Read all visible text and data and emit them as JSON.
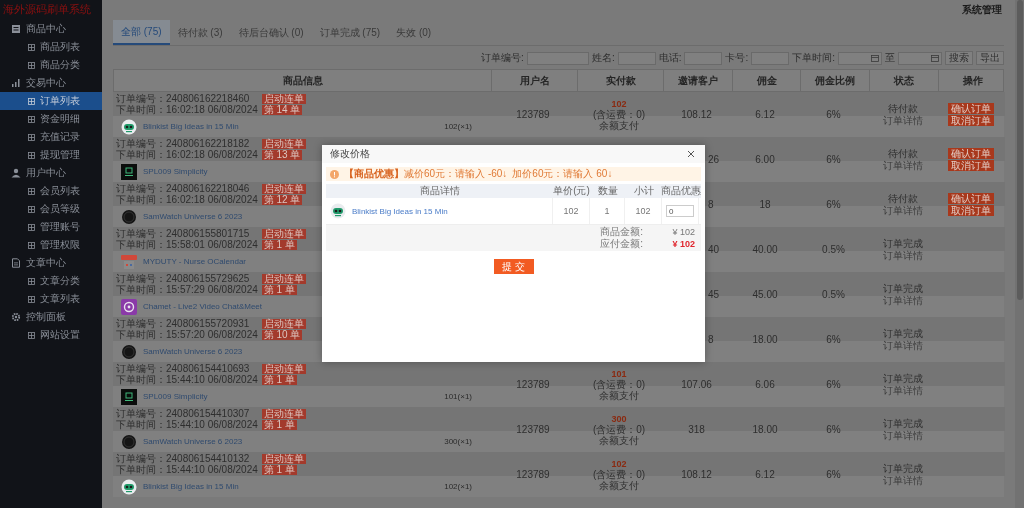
{
  "sidebar": {
    "title": "海外源码刷单系统",
    "groups": [
      {
        "label": "商品中心",
        "children": [
          {
            "label": "商品列表",
            "selected": false
          },
          {
            "label": "商品分类",
            "selected": false
          }
        ]
      },
      {
        "label": "交易中心",
        "children": [
          {
            "label": "订单列表",
            "selected": true
          },
          {
            "label": "资金明细",
            "selected": false
          },
          {
            "label": "充值记录",
            "selected": false
          },
          {
            "label": "提现管理",
            "selected": false
          }
        ]
      },
      {
        "label": "用户中心",
        "children": [
          {
            "label": "会员列表",
            "selected": false
          },
          {
            "label": "会员等级",
            "selected": false
          },
          {
            "label": "管理账号",
            "selected": false
          },
          {
            "label": "管理权限",
            "selected": false
          }
        ]
      },
      {
        "label": "文章中心",
        "children": [
          {
            "label": "文章分类",
            "selected": false
          },
          {
            "label": "文章列表",
            "selected": false
          }
        ]
      },
      {
        "label": "控制面板",
        "children": [
          {
            "label": "网站设置",
            "selected": false
          }
        ]
      }
    ]
  },
  "header": {
    "user_menu": "系统管理"
  },
  "tabs": [
    {
      "label": "全部 (75)",
      "selected": true
    },
    {
      "label": "待付款 (3)",
      "selected": false
    },
    {
      "label": "待后台确认 (0)",
      "selected": false
    },
    {
      "label": "订单完成 (75)",
      "selected": false
    },
    {
      "label": "失效 (0)",
      "selected": false
    }
  ],
  "filters": {
    "fields": [
      {
        "label": "订单编号:"
      },
      {
        "label": "姓名:"
      },
      {
        "label": "电话:"
      },
      {
        "label": "卡号:"
      }
    ],
    "date_label": "下单时间:",
    "date_separator": "至",
    "buttons": [
      "搜索",
      "导出"
    ]
  },
  "table": {
    "columns": [
      "商品信息",
      "用户名",
      "实付款",
      "邀请客户",
      "佣金",
      "佣金比例",
      "状态",
      "操作"
    ],
    "rows": [
      {
        "order_no": "订单编号：240806162218460",
        "time": "下单时间：16:02:18 06/08/2024",
        "badges": [
          "启动连单",
          "第 14 单"
        ],
        "product": {
          "name": "Blinkist Big Ideas in 15 Min",
          "kind": "robot"
        },
        "qty": "102(×1)",
        "user": "123789",
        "paid": {
          "amount": "102",
          "shipping": "(含运费：0)",
          "method": "余额支付"
        },
        "invite": "108.12",
        "commission": "6.12",
        "ratio": "6%",
        "status": "待付款",
        "detail": "订单详情",
        "actions": [
          "确认订单",
          "取消订单"
        ]
      },
      {
        "order_no": "订单编号：240806162218182",
        "time": "下单时间：16:02:18 06/08/2024",
        "badges": [
          "启动连单",
          "第 13 单"
        ],
        "product": {
          "name": "SPL009 Simplicity",
          "kind": "watch"
        },
        "invite": "26",
        "commission": "6.00",
        "ratio": "6%",
        "status": "待付款",
        "detail": "订单详情",
        "actions": [
          "确认订单",
          "取消订单"
        ]
      },
      {
        "order_no": "订单编号：240806162218046",
        "time": "下单时间：16:02:18 06/08/2024",
        "badges": [
          "启动连单",
          "第 12 单"
        ],
        "product": {
          "name": "SamWatch Universe 6 2023",
          "kind": "disc"
        },
        "invite": "8",
        "commission": "18",
        "ratio": "6%",
        "status": "待付款",
        "detail": "订单详情",
        "actions": [
          "确认订单",
          "取消订单"
        ]
      },
      {
        "order_no": "订单编号：240806155801715",
        "time": "下单时间：15:58:01 06/08/2024",
        "badges": [
          "启动连单",
          "第 1 单"
        ],
        "product": {
          "name": "MYDUTY - Nurse OCalendar",
          "kind": "calendar"
        },
        "invite": "40",
        "commission": "40.00",
        "ratio": "0.5%",
        "status": "订单完成",
        "detail": "订单详情"
      },
      {
        "order_no": "订单编号：240806155729625",
        "time": "下单时间：15:57:29 06/08/2024",
        "badges": [
          "启动连单",
          "第 1 单"
        ],
        "product": {
          "name": "Chamet - Live2 Video Chat&Meet",
          "kind": "chat"
        },
        "invite": "45",
        "commission": "45.00",
        "ratio": "0.5%",
        "status": "订单完成",
        "detail": "订单详情"
      },
      {
        "order_no": "订单编号：240806155720931",
        "time": "下单时间：15:57:20 06/08/2024",
        "badges": [
          "启动连单",
          "第 10 单"
        ],
        "product": {
          "name": "SamWatch Universe 6 2023",
          "kind": "disc"
        },
        "invite": "8",
        "commission": "18.00",
        "ratio": "6%",
        "status": "订单完成",
        "detail": "订单详情"
      },
      {
        "order_no": "订单编号：240806154410693",
        "time": "下单时间：15:44:10 06/08/2024",
        "badges": [
          "启动连单",
          "第 1 单"
        ],
        "product": {
          "name": "SPL009 Simplicity",
          "kind": "watch"
        },
        "qty": "101(×1)",
        "user": "123789",
        "paid": {
          "amount": "101",
          "shipping": "(含运费：0)",
          "method": "余额支付"
        },
        "invite": "107.06",
        "commission": "6.06",
        "ratio": "6%",
        "status": "订单完成",
        "detail": "订单详情"
      },
      {
        "order_no": "订单编号：240806154410307",
        "time": "下单时间：15:44:10 06/08/2024",
        "badges": [
          "启动连单",
          "第 1 单"
        ],
        "product": {
          "name": "SamWatch Universe 6 2023",
          "kind": "disc"
        },
        "qty": "300(×1)",
        "user": "123789",
        "paid": {
          "amount": "300",
          "shipping": "(含运费：0)",
          "method": "余额支付"
        },
        "invite": "318",
        "commission": "18.00",
        "ratio": "6%",
        "status": "订单完成",
        "detail": "订单详情"
      },
      {
        "order_no": "订单编号：240806154410132",
        "time": "下单时间：15:44:10 06/08/2024",
        "badges": [
          "启动连单",
          "第 1 单"
        ],
        "product": {
          "name": "Blinkist Big Ideas in 15 Min",
          "kind": "robot"
        },
        "qty": "102(×1)",
        "user": "123789",
        "paid": {
          "amount": "102",
          "shipping": "(含运费：0)",
          "method": "余额支付"
        },
        "invite": "108.12",
        "commission": "6.12",
        "ratio": "6%",
        "status": "订单完成",
        "detail": "订单详情"
      }
    ]
  },
  "modal": {
    "title": "修改价格",
    "notice": "**【商品优惠】**减价60元：请输入 -60↓",
    "notice_2": "加价60元：请输入 60↓",
    "columns": [
      "商品详情",
      "单价(元)",
      "数量",
      "小计",
      "商品优惠"
    ],
    "item": {
      "name": "Blinkist Big Ideas in 15 Min",
      "kind": "robot",
      "price": "102",
      "qty": "1",
      "subtotal": "102",
      "discount": "0"
    },
    "summary": [
      {
        "label": "商品金额:",
        "value": "¥ 102",
        "kind": "plain"
      },
      {
        "label": "应付金额:",
        "value": "¥ 102",
        "kind": "total"
      }
    ],
    "submit": "提 交"
  }
}
